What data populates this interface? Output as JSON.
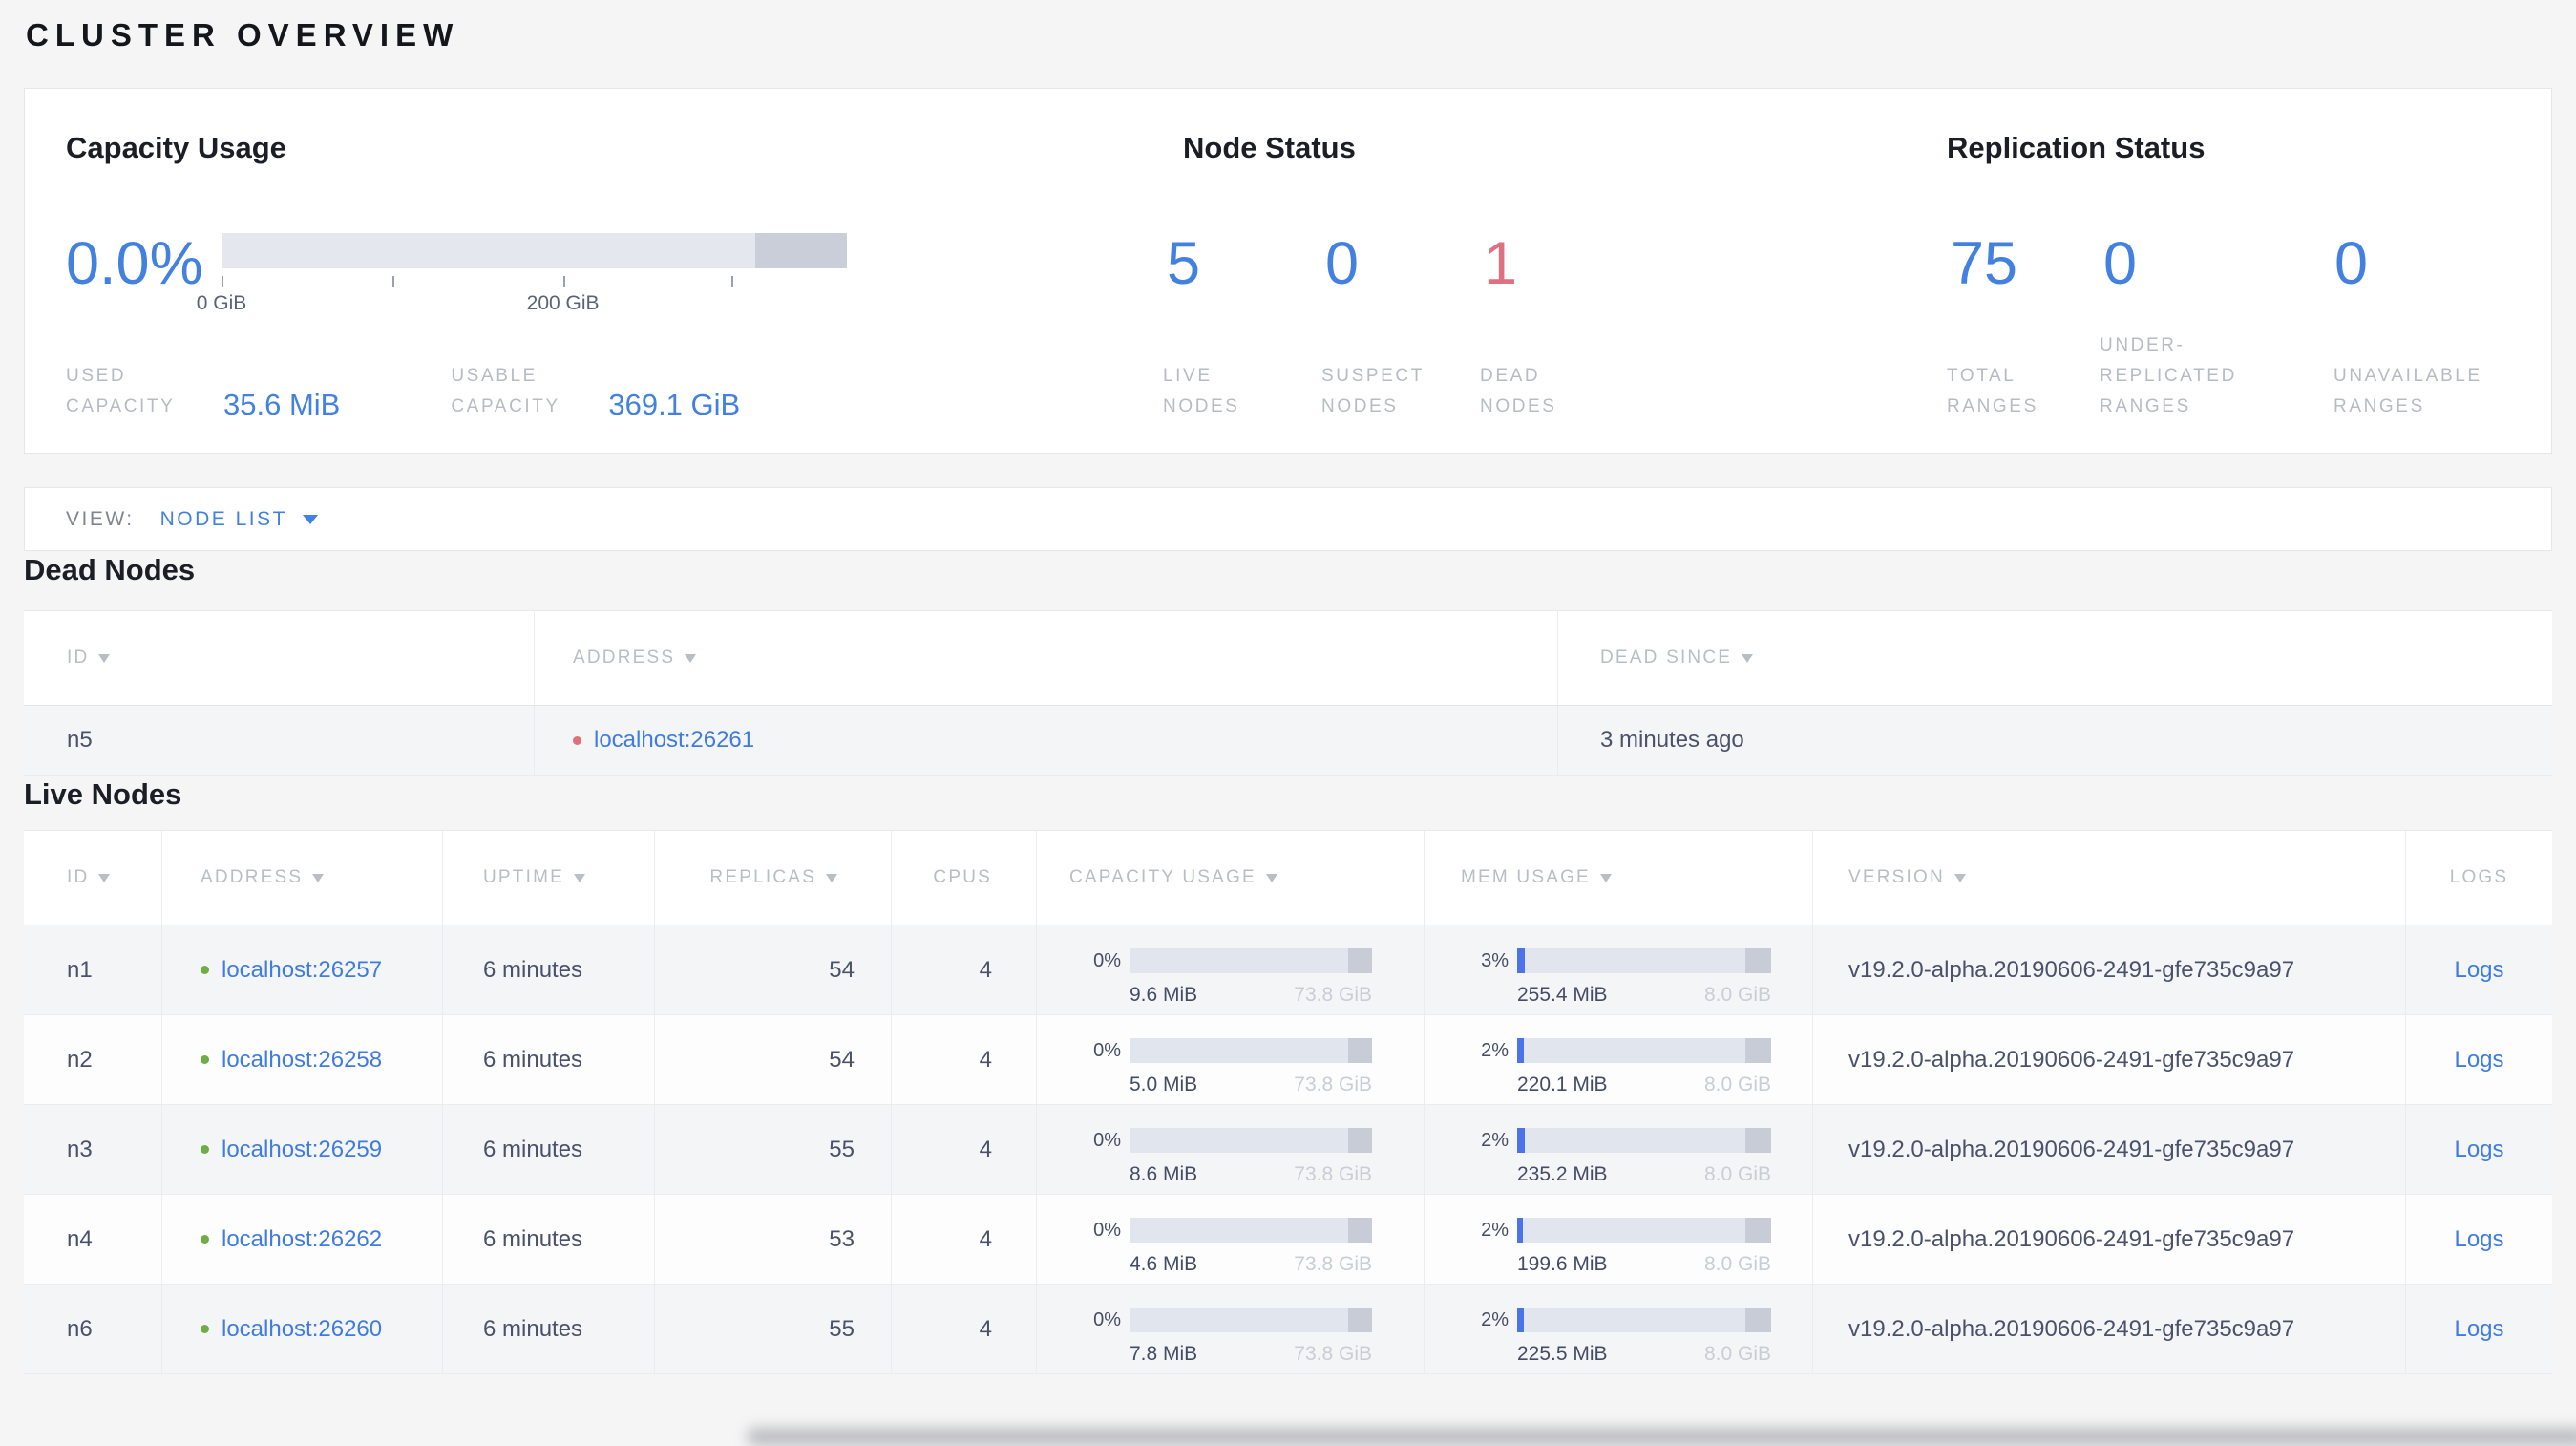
{
  "page": {
    "title": "CLUSTER OVERVIEW"
  },
  "colors": {
    "accent_blue": "#4381e0",
    "alert_red": "#de707f",
    "live_green": "#6ead45",
    "dead_red": "#df7079"
  },
  "summary": {
    "capacity": {
      "title": "Capacity Usage",
      "percent": "0.0%",
      "tick_labels": [
        "0 GiB",
        "200 GiB"
      ],
      "used": {
        "label": "USED\nCAPACITY",
        "value": "35.6 MiB"
      },
      "usable": {
        "label": "USABLE\nCAPACITY",
        "value": "369.1 GiB"
      },
      "bar": {
        "used_fill_pct": 0
      }
    },
    "nodes": {
      "title": "Node Status",
      "stats": [
        {
          "value": "5",
          "label": "LIVE\nNODES"
        },
        {
          "value": "0",
          "label": "SUSPECT\nNODES"
        },
        {
          "value": "1",
          "label": "DEAD\nNODES"
        }
      ]
    },
    "replication": {
      "title": "Replication Status",
      "stats": [
        {
          "value": "75",
          "label": "TOTAL\nRANGES"
        },
        {
          "value": "0",
          "label": "UNDER-\nREPLICATED\nRANGES"
        },
        {
          "value": "0",
          "label": "UNAVAILABLE\nRANGES"
        }
      ]
    }
  },
  "view_bar": {
    "label": "VIEW:",
    "selected": "NODE LIST"
  },
  "dead_nodes": {
    "title": "Dead Nodes",
    "headers": [
      "ID",
      "ADDRESS",
      "DEAD SINCE"
    ],
    "rows": [
      {
        "id": "n5",
        "address": "localhost:26261",
        "dead_since": "3 minutes ago"
      }
    ]
  },
  "live_nodes": {
    "title": "Live Nodes",
    "headers": [
      "ID",
      "ADDRESS",
      "UPTIME",
      "REPLICAS",
      "CPUS",
      "CAPACITY USAGE",
      "MEM USAGE",
      "VERSION",
      "LOGS"
    ],
    "rows": [
      {
        "id": "n1",
        "address": "localhost:26257",
        "uptime": "6 minutes",
        "replicas": "54",
        "cpus": "4",
        "capacity": {
          "pct": "0%",
          "fill": 0,
          "used": "9.6 MiB",
          "total": "73.8 GiB"
        },
        "memory": {
          "pct": "3%",
          "fill": 3.1,
          "used": "255.4 MiB",
          "total": "8.0 GiB"
        },
        "version": "v19.2.0-alpha.20190606-2491-gfe735c9a97",
        "logs": "Logs"
      },
      {
        "id": "n2",
        "address": "localhost:26258",
        "uptime": "6 minutes",
        "replicas": "54",
        "cpus": "4",
        "capacity": {
          "pct": "0%",
          "fill": 0,
          "used": "5.0 MiB",
          "total": "73.8 GiB"
        },
        "memory": {
          "pct": "2%",
          "fill": 2.7,
          "used": "220.1 MiB",
          "total": "8.0 GiB"
        },
        "version": "v19.2.0-alpha.20190606-2491-gfe735c9a97",
        "logs": "Logs"
      },
      {
        "id": "n3",
        "address": "localhost:26259",
        "uptime": "6 minutes",
        "replicas": "55",
        "cpus": "4",
        "capacity": {
          "pct": "0%",
          "fill": 0,
          "used": "8.6 MiB",
          "total": "73.8 GiB"
        },
        "memory": {
          "pct": "2%",
          "fill": 2.9,
          "used": "235.2 MiB",
          "total": "8.0 GiB"
        },
        "version": "v19.2.0-alpha.20190606-2491-gfe735c9a97",
        "logs": "Logs"
      },
      {
        "id": "n4",
        "address": "localhost:26262",
        "uptime": "6 minutes",
        "replicas": "53",
        "cpus": "4",
        "capacity": {
          "pct": "0%",
          "fill": 0,
          "used": "4.6 MiB",
          "total": "73.8 GiB"
        },
        "memory": {
          "pct": "2%",
          "fill": 2.4,
          "used": "199.6 MiB",
          "total": "8.0 GiB"
        },
        "version": "v19.2.0-alpha.20190606-2491-gfe735c9a97",
        "logs": "Logs"
      },
      {
        "id": "n6",
        "address": "localhost:26260",
        "uptime": "6 minutes",
        "replicas": "55",
        "cpus": "4",
        "capacity": {
          "pct": "0%",
          "fill": 0,
          "used": "7.8 MiB",
          "total": "73.8 GiB"
        },
        "memory": {
          "pct": "2%",
          "fill": 2.8,
          "used": "225.5 MiB",
          "total": "8.0 GiB"
        },
        "version": "v19.2.0-alpha.20190606-2491-gfe735c9a97",
        "logs": "Logs"
      }
    ]
  }
}
